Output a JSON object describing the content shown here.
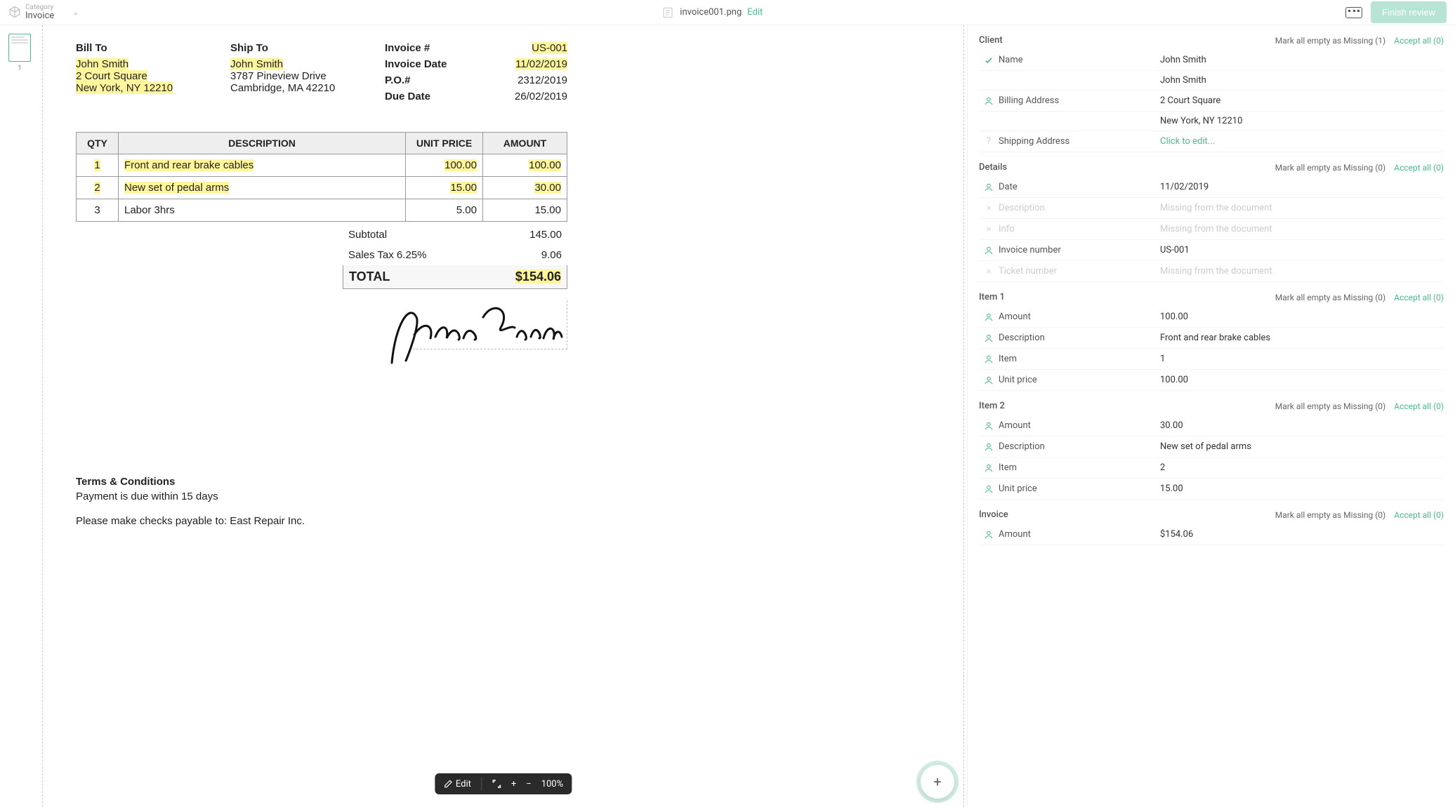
{
  "topbar": {
    "category_label": "Category",
    "category_value": "Invoice",
    "file_name": "invoice001.png",
    "edit": "Edit",
    "finish": "Finish review"
  },
  "thumbs": {
    "page1": "1"
  },
  "doc": {
    "bill_to_h": "Bill To",
    "bill_to": [
      "John Smith",
      "2 Court Square",
      "New York, NY 12210"
    ],
    "ship_to_h": "Ship To",
    "ship_to": [
      "John Smith",
      "3787 Pineview Drive",
      "Cambridge, MA 42210"
    ],
    "meta": {
      "invoice_no_k": "Invoice #",
      "invoice_no_v": "US-001",
      "invoice_date_k": "Invoice Date",
      "invoice_date_v": "11/02/2019",
      "po_k": "P.O.#",
      "po_v": "2312/2019",
      "due_k": "Due Date",
      "due_v": "26/02/2019"
    },
    "th": {
      "qty": "QTY",
      "desc": "DESCRIPTION",
      "unit": "UNIT PRICE",
      "amt": "AMOUNT"
    },
    "rows": [
      {
        "qty": "1",
        "desc": "Front and rear brake cables",
        "unit": "100.00",
        "amt": "100.00",
        "hl": true
      },
      {
        "qty": "2",
        "desc": "New set of pedal arms",
        "unit": "15.00",
        "amt": "30.00",
        "hl": true
      },
      {
        "qty": "3",
        "desc": "Labor 3hrs",
        "unit": "5.00",
        "amt": "15.00",
        "hl": false
      }
    ],
    "subtotal_k": "Subtotal",
    "subtotal_v": "145.00",
    "tax_k": "Sales Tax 6.25%",
    "tax_v": "9.06",
    "total_k": "TOTAL",
    "total_v": "$154.06",
    "terms_h": "Terms & Conditions",
    "terms_body": "Payment is due within 15 days",
    "payable": "Please make checks payable to: East Repair Inc."
  },
  "viewbar": {
    "edit": "Edit",
    "zoom": "100%"
  },
  "panel": {
    "sections": {
      "client": {
        "title": "Client",
        "mark": "Mark all empty as Missing (1)",
        "accept": "Accept all (0)",
        "rows": [
          {
            "icon": "check",
            "label": "Name",
            "value": "John Smith"
          },
          {
            "icon": "",
            "label": "",
            "value": "John Smith"
          },
          {
            "icon": "user",
            "label": "Billing Address",
            "value": "2 Court Square"
          },
          {
            "icon": "",
            "label": "",
            "value": "New York, NY 12210"
          },
          {
            "icon": "q",
            "label": "Shipping Address",
            "value": "Click to edit...",
            "edit": true
          }
        ]
      },
      "details": {
        "title": "Details",
        "mark": "Mark all empty as Missing (0)",
        "accept": "Accept all (0)",
        "rows": [
          {
            "icon": "user",
            "label": "Date",
            "value": "11/02/2019"
          },
          {
            "icon": "x",
            "label": "Description",
            "value": "Missing from the document",
            "miss": true
          },
          {
            "icon": "x",
            "label": "Info",
            "value": "Missing from the document",
            "miss": true
          },
          {
            "icon": "user",
            "label": "Invoice number",
            "value": "US-001"
          },
          {
            "icon": "x",
            "label": "Ticket number",
            "value": "Missing from the document",
            "miss": true
          }
        ]
      },
      "item1": {
        "title": "Item 1",
        "mark": "Mark all empty as Missing (0)",
        "accept": "Accept all (0)",
        "rows": [
          {
            "icon": "user",
            "label": "Amount",
            "value": "100.00"
          },
          {
            "icon": "user",
            "label": "Description",
            "value": "Front and rear brake cables"
          },
          {
            "icon": "user",
            "label": "Item",
            "value": "1"
          },
          {
            "icon": "user",
            "label": "Unit price",
            "value": "100.00"
          }
        ]
      },
      "item2": {
        "title": "Item 2",
        "mark": "Mark all empty as Missing (0)",
        "accept": "Accept all (0)",
        "rows": [
          {
            "icon": "user",
            "label": "Amount",
            "value": "30.00"
          },
          {
            "icon": "user",
            "label": "Description",
            "value": "New set of pedal arms"
          },
          {
            "icon": "user",
            "label": "Item",
            "value": "2"
          },
          {
            "icon": "user",
            "label": "Unit price",
            "value": "15.00"
          }
        ]
      },
      "invoice": {
        "title": "Invoice",
        "mark": "Mark all empty as Missing (0)",
        "accept": "Accept all (0)",
        "rows": [
          {
            "icon": "user",
            "label": "Amount",
            "value": "$154.06"
          }
        ]
      }
    }
  }
}
